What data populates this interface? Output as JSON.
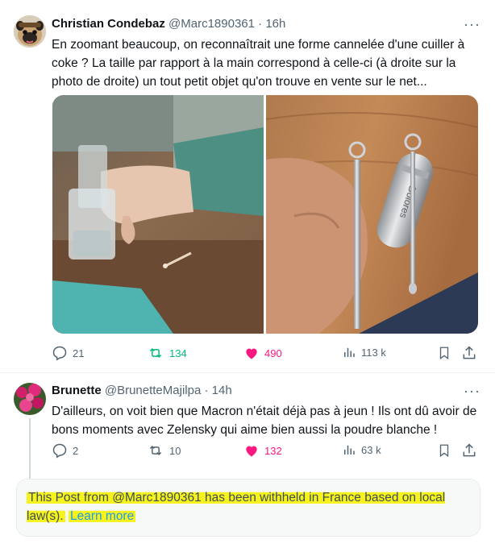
{
  "tweet1": {
    "name": "Christian Condebaz",
    "handle": "@Marc1890361",
    "time": "16h",
    "more": "···",
    "text": "En zoomant beaucoup, on reconnaîtrait une forme cannelée d'une cuiller à coke ? La taille par rapport à la main correspond à celle-ci (à droite sur la photo de droite) un tout petit objet qu'on trouve en vente sur le net...",
    "replies": "21",
    "reposts": "134",
    "likes": "490",
    "views": "113 k",
    "media_engraving": "Dolores",
    "colors": {
      "repost": "#00ba7c",
      "like": "#f91880"
    }
  },
  "tweet2": {
    "name": "Brunette",
    "handle": "@BrunetteMajilpa",
    "time": "14h",
    "more": "···",
    "text": "D'ailleurs, on voit bien que Macron n'était déjà pas à jeun ! Ils ont dû avoir de bons moments avec Zelensky qui aime bien aussi la poudre blanche !",
    "replies": "2",
    "reposts": "10",
    "likes": "132",
    "views": "63 k",
    "colors": {
      "like": "#f91880"
    }
  },
  "notice": {
    "text": "This Post from @Marc1890361 has been withheld in France based on local law(s).",
    "link": "Learn more",
    "highlight": "#f6f31c",
    "link_color": "#1d9bf0"
  }
}
